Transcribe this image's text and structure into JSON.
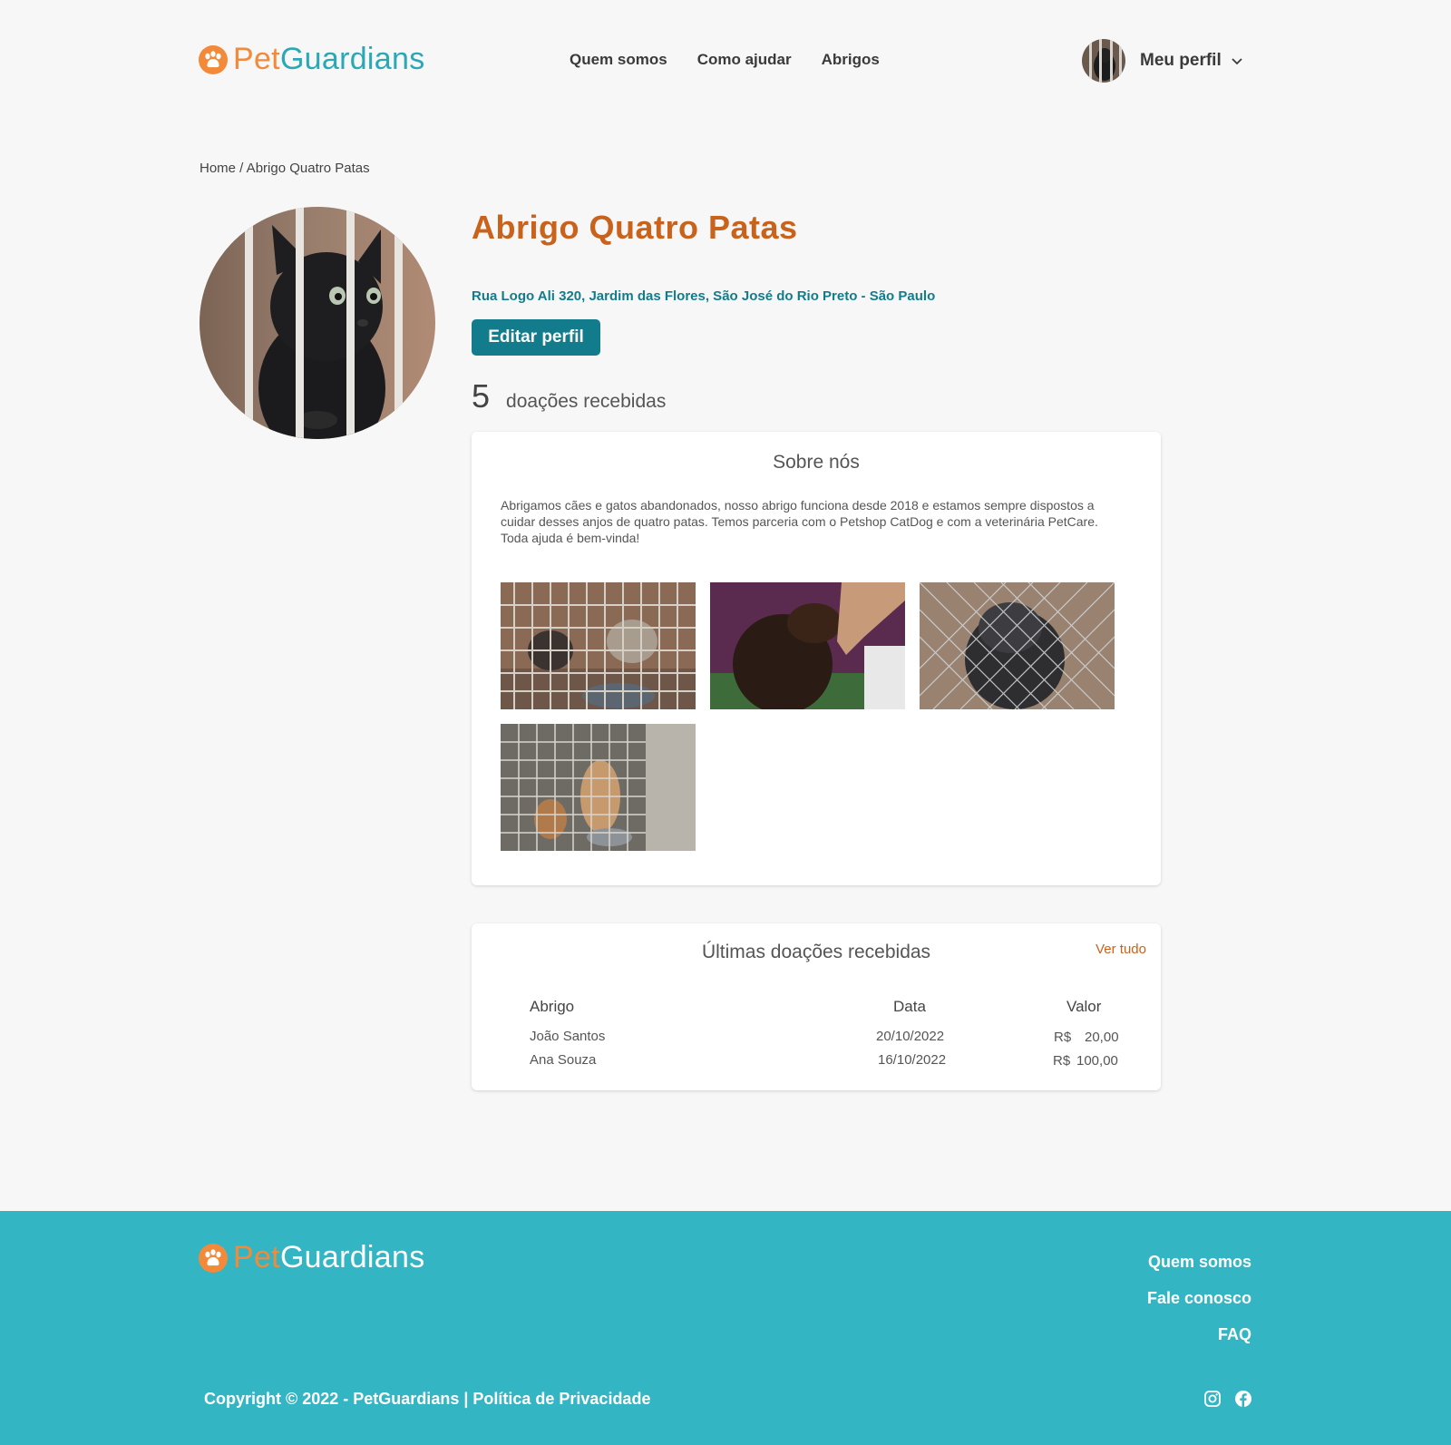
{
  "brand": {
    "pet": "Pet",
    "guardians": "Guardians"
  },
  "nav": {
    "items": [
      "Quem somos",
      "Como ajudar",
      "Abrigos"
    ]
  },
  "profile": {
    "label": "Meu perfil"
  },
  "breadcrumb": "Home / Abrigo Quatro Patas",
  "shelter": {
    "name": "Abrigo Quatro Patas",
    "address": "Rua Logo Ali 320, Jardim das Flores, São José do Rio Preto - São Paulo",
    "edit_label": "Editar perfil",
    "donations_count": "5",
    "donations_label": "doações recebidas"
  },
  "about": {
    "title": "Sobre nós",
    "text": "Abrigamos cães e gatos abandonados, nosso abrigo funciona desde 2018 e estamos sempre dispostos a cuidar desses anjos de quatro patas. Temos parceria com o Petshop CatDog e com a veterinária PetCare. Toda ajuda é bem-vinda!"
  },
  "recent": {
    "title": "Últimas doações recebidas",
    "see_all": "Ver tudo",
    "headers": [
      "Abrigo",
      "Data",
      "Valor"
    ],
    "rows": [
      {
        "name": "João Santos",
        "date": "20/10/2022",
        "currency": "R$",
        "amount": "20,00"
      },
      {
        "name": "Ana Souza",
        "date": "16/10/2022",
        "currency": "R$",
        "amount": "100,00"
      }
    ]
  },
  "footer": {
    "links": [
      "Quem somos",
      "Fale conosco",
      "FAQ"
    ],
    "copyright": "Copyright © 2022 - PetGuardians | Política de Privacidade"
  },
  "colors": {
    "orange": "#f28a3a",
    "teal": "#2aa8b6",
    "dark_teal": "#137c8c",
    "footer_bg": "#34b5c4",
    "title": "#c9621a"
  }
}
